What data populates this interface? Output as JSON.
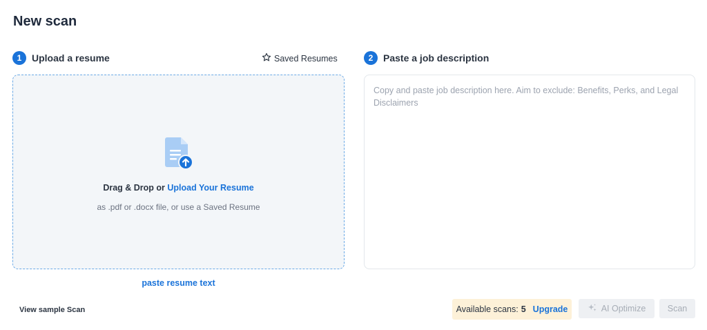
{
  "page": {
    "title": "New scan"
  },
  "upload": {
    "step_number": "1",
    "heading": "Upload a resume",
    "saved_resumes_label": "Saved Resumes",
    "drop_prefix": "Drag & Drop or ",
    "upload_link": "Upload Your Resume",
    "drop_hint": "as .pdf or .docx file, or use a Saved Resume",
    "paste_text_link": "paste resume text"
  },
  "job": {
    "step_number": "2",
    "heading": "Paste a job description",
    "value": "",
    "placeholder": "Copy and paste job description here. Aim to exclude: Benefits, Perks, and Legal Disclaimers"
  },
  "footer": {
    "sample_scan_link": "View sample Scan",
    "available_scans_label": "Available scans:",
    "available_scans_count": "5",
    "upgrade_link": "Upgrade",
    "ai_optimize_label": "AI Optimize",
    "scan_label": "Scan"
  },
  "colors": {
    "accent": "#1a73d9",
    "dropzone_bg": "#f3f6f9",
    "scans_badge_bg": "#fdf1d8"
  },
  "icons": {
    "star": "star-icon",
    "document_upload": "document-upload-icon",
    "sparkle": "sparkle-icon"
  }
}
